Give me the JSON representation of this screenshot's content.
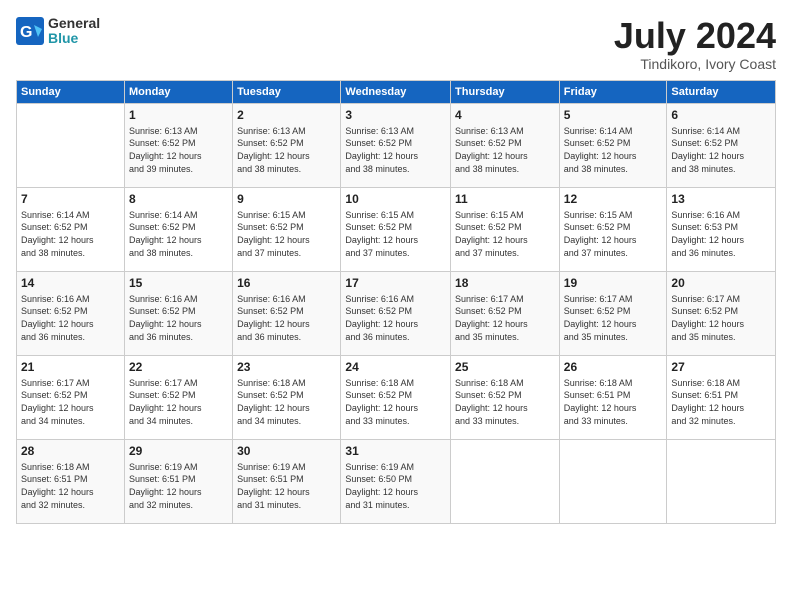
{
  "header": {
    "logo_line1": "General",
    "logo_line2": "Blue",
    "month": "July 2024",
    "location": "Tindikoro, Ivory Coast"
  },
  "days_of_week": [
    "Sunday",
    "Monday",
    "Tuesday",
    "Wednesday",
    "Thursday",
    "Friday",
    "Saturday"
  ],
  "weeks": [
    [
      {
        "day": "",
        "info": ""
      },
      {
        "day": "1",
        "info": "Sunrise: 6:13 AM\nSunset: 6:52 PM\nDaylight: 12 hours\nand 39 minutes."
      },
      {
        "day": "2",
        "info": "Sunrise: 6:13 AM\nSunset: 6:52 PM\nDaylight: 12 hours\nand 38 minutes."
      },
      {
        "day": "3",
        "info": "Sunrise: 6:13 AM\nSunset: 6:52 PM\nDaylight: 12 hours\nand 38 minutes."
      },
      {
        "day": "4",
        "info": "Sunrise: 6:13 AM\nSunset: 6:52 PM\nDaylight: 12 hours\nand 38 minutes."
      },
      {
        "day": "5",
        "info": "Sunrise: 6:14 AM\nSunset: 6:52 PM\nDaylight: 12 hours\nand 38 minutes."
      },
      {
        "day": "6",
        "info": "Sunrise: 6:14 AM\nSunset: 6:52 PM\nDaylight: 12 hours\nand 38 minutes."
      }
    ],
    [
      {
        "day": "7",
        "info": "Sunrise: 6:14 AM\nSunset: 6:52 PM\nDaylight: 12 hours\nand 38 minutes."
      },
      {
        "day": "8",
        "info": "Sunrise: 6:14 AM\nSunset: 6:52 PM\nDaylight: 12 hours\nand 38 minutes."
      },
      {
        "day": "9",
        "info": "Sunrise: 6:15 AM\nSunset: 6:52 PM\nDaylight: 12 hours\nand 37 minutes."
      },
      {
        "day": "10",
        "info": "Sunrise: 6:15 AM\nSunset: 6:52 PM\nDaylight: 12 hours\nand 37 minutes."
      },
      {
        "day": "11",
        "info": "Sunrise: 6:15 AM\nSunset: 6:52 PM\nDaylight: 12 hours\nand 37 minutes."
      },
      {
        "day": "12",
        "info": "Sunrise: 6:15 AM\nSunset: 6:52 PM\nDaylight: 12 hours\nand 37 minutes."
      },
      {
        "day": "13",
        "info": "Sunrise: 6:16 AM\nSunset: 6:53 PM\nDaylight: 12 hours\nand 36 minutes."
      }
    ],
    [
      {
        "day": "14",
        "info": "Sunrise: 6:16 AM\nSunset: 6:52 PM\nDaylight: 12 hours\nand 36 minutes."
      },
      {
        "day": "15",
        "info": "Sunrise: 6:16 AM\nSunset: 6:52 PM\nDaylight: 12 hours\nand 36 minutes."
      },
      {
        "day": "16",
        "info": "Sunrise: 6:16 AM\nSunset: 6:52 PM\nDaylight: 12 hours\nand 36 minutes."
      },
      {
        "day": "17",
        "info": "Sunrise: 6:16 AM\nSunset: 6:52 PM\nDaylight: 12 hours\nand 36 minutes."
      },
      {
        "day": "18",
        "info": "Sunrise: 6:17 AM\nSunset: 6:52 PM\nDaylight: 12 hours\nand 35 minutes."
      },
      {
        "day": "19",
        "info": "Sunrise: 6:17 AM\nSunset: 6:52 PM\nDaylight: 12 hours\nand 35 minutes."
      },
      {
        "day": "20",
        "info": "Sunrise: 6:17 AM\nSunset: 6:52 PM\nDaylight: 12 hours\nand 35 minutes."
      }
    ],
    [
      {
        "day": "21",
        "info": "Sunrise: 6:17 AM\nSunset: 6:52 PM\nDaylight: 12 hours\nand 34 minutes."
      },
      {
        "day": "22",
        "info": "Sunrise: 6:17 AM\nSunset: 6:52 PM\nDaylight: 12 hours\nand 34 minutes."
      },
      {
        "day": "23",
        "info": "Sunrise: 6:18 AM\nSunset: 6:52 PM\nDaylight: 12 hours\nand 34 minutes."
      },
      {
        "day": "24",
        "info": "Sunrise: 6:18 AM\nSunset: 6:52 PM\nDaylight: 12 hours\nand 33 minutes."
      },
      {
        "day": "25",
        "info": "Sunrise: 6:18 AM\nSunset: 6:52 PM\nDaylight: 12 hours\nand 33 minutes."
      },
      {
        "day": "26",
        "info": "Sunrise: 6:18 AM\nSunset: 6:51 PM\nDaylight: 12 hours\nand 33 minutes."
      },
      {
        "day": "27",
        "info": "Sunrise: 6:18 AM\nSunset: 6:51 PM\nDaylight: 12 hours\nand 32 minutes."
      }
    ],
    [
      {
        "day": "28",
        "info": "Sunrise: 6:18 AM\nSunset: 6:51 PM\nDaylight: 12 hours\nand 32 minutes."
      },
      {
        "day": "29",
        "info": "Sunrise: 6:19 AM\nSunset: 6:51 PM\nDaylight: 12 hours\nand 32 minutes."
      },
      {
        "day": "30",
        "info": "Sunrise: 6:19 AM\nSunset: 6:51 PM\nDaylight: 12 hours\nand 31 minutes."
      },
      {
        "day": "31",
        "info": "Sunrise: 6:19 AM\nSunset: 6:50 PM\nDaylight: 12 hours\nand 31 minutes."
      },
      {
        "day": "",
        "info": ""
      },
      {
        "day": "",
        "info": ""
      },
      {
        "day": "",
        "info": ""
      }
    ]
  ]
}
